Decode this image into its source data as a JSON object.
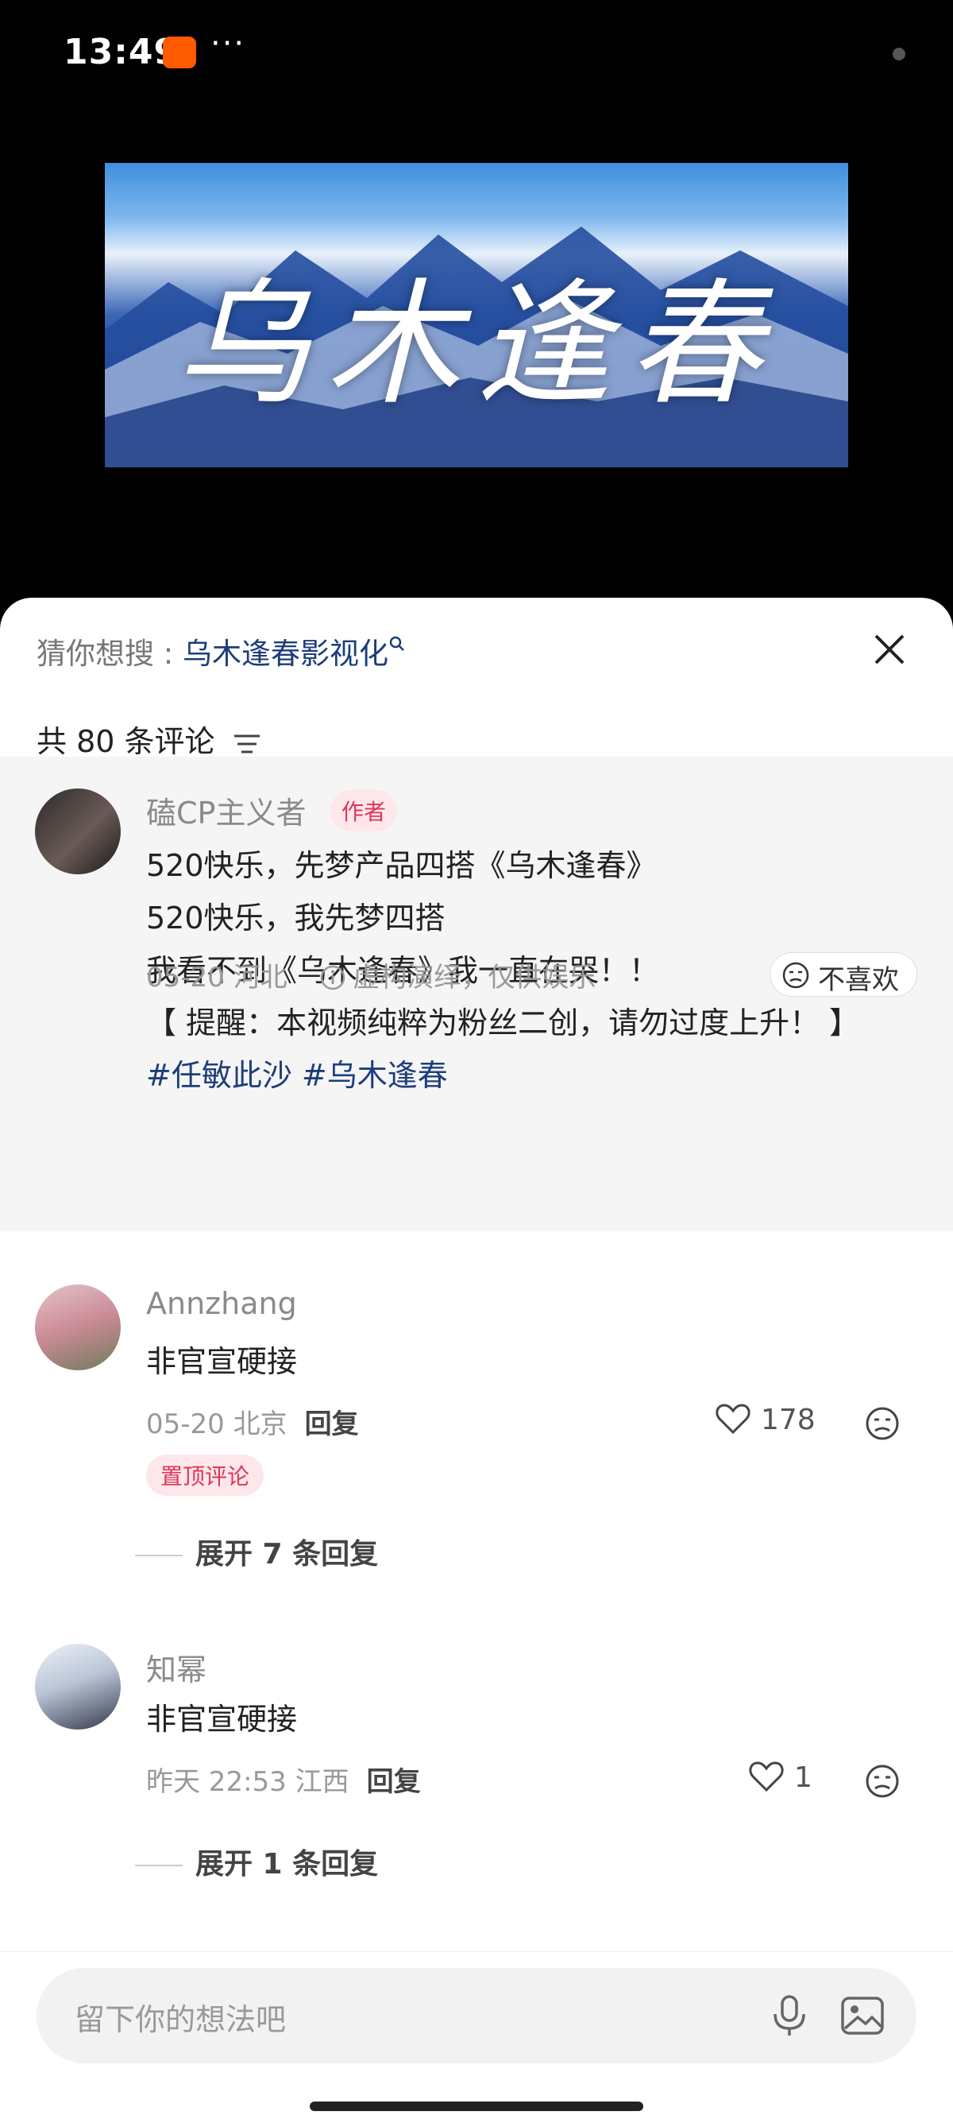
{
  "status_bar": {
    "time": "13:49",
    "more": "···"
  },
  "video": {
    "banner_title": "乌木逢春"
  },
  "sheet": {
    "suggest_label": "猜你想搜 : ",
    "suggest_query": "乌木逢春影视化",
    "comment_count": "共 80 条评论"
  },
  "author_comment": {
    "username": "磕CP主义者",
    "badge": "作者",
    "lines": [
      "520快乐，先梦产品四搭《乌木逢春》",
      "520快乐，我先梦四搭",
      "我看不到《乌木逢春》我一直在哭！！",
      "【 提醒：本视频纯粹为粉丝二创，请勿过度上升！ 】"
    ],
    "hashtags": "#任敏此沙 #乌木逢春",
    "date_location": "05-20 河北",
    "disclaimer": "虚构演绎，仅供娱乐",
    "dislike_label": "不喜欢"
  },
  "comments": [
    {
      "username": "Annzhang",
      "text": "非官宣硬接",
      "date_location": "05-20 北京",
      "reply_label": "回复",
      "likes": "178",
      "pinned_label": "置顶评论",
      "expand_label": "展开 7 条回复"
    },
    {
      "username": "知幂",
      "text": "非官宣硬接",
      "date_location": "昨天 22:53 江西",
      "reply_label": "回复",
      "likes": "1",
      "expand_label": "展开 1 条回复"
    }
  ],
  "input": {
    "placeholder": "留下你的想法吧"
  },
  "icons": [
    "close-icon",
    "sort-icon",
    "search-icon",
    "info-icon",
    "dislike-face-icon",
    "heart-icon",
    "mic-icon",
    "image-icon"
  ]
}
